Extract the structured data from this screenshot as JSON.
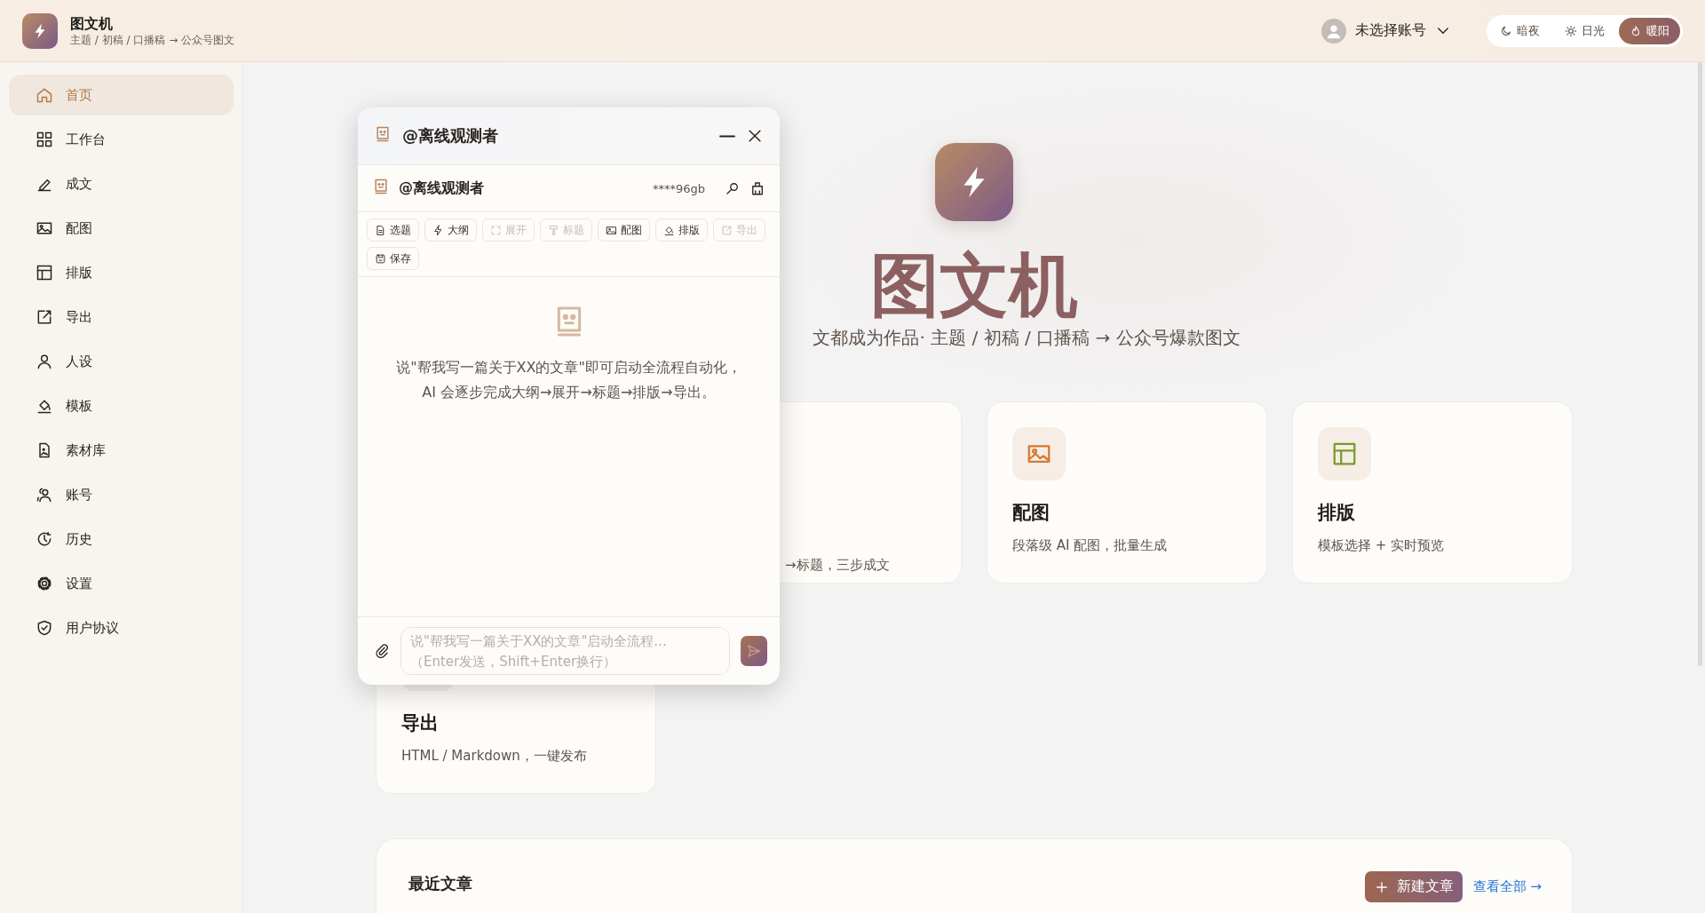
{
  "app": {
    "title": "图文机",
    "breadcrumb": "主题 / 初稿 / 口播稿 → 公众号图文"
  },
  "account": {
    "label": "未选择账号"
  },
  "themes": [
    {
      "label": "暗夜",
      "selected": false
    },
    {
      "label": "日光",
      "selected": false
    },
    {
      "label": "暖阳",
      "selected": true
    }
  ],
  "sidebar": {
    "items": [
      {
        "label": "首页",
        "selected": true
      },
      {
        "label": "工作台",
        "selected": false
      },
      {
        "label": "成文",
        "selected": false
      },
      {
        "label": "配图",
        "selected": false
      },
      {
        "label": "排版",
        "selected": false
      },
      {
        "label": "导出",
        "selected": false
      },
      {
        "label": "人设",
        "selected": false
      },
      {
        "label": "模板",
        "selected": false
      },
      {
        "label": "素材库",
        "selected": false
      },
      {
        "label": "账号",
        "selected": false
      },
      {
        "label": "历史",
        "selected": false
      },
      {
        "label": "设置",
        "selected": false
      },
      {
        "label": "用户协议",
        "selected": false
      }
    ]
  },
  "hero": {
    "title": "图文机",
    "subtitle": "文都成为作品· 主题 / 初稿 / 口播稿 → 公众号爆款图文"
  },
  "features": [
    {
      "kind": "partial",
      "description": "→标题，三步成文"
    },
    {
      "kind": "image",
      "title": "配图",
      "description": "段落级 AI 配图，批量生成"
    },
    {
      "kind": "layout",
      "title": "排版",
      "description": "模板选择 + 实时预览"
    },
    {
      "kind": "export",
      "title": "导出",
      "description": "HTML / Markdown，一键发布"
    }
  ],
  "recent": {
    "title": "最近文章",
    "new_button": "新建文章",
    "view_all": "查看全部 →"
  },
  "chat": {
    "title": "@离线观测者",
    "account": "@离线观测者",
    "key": "****96gb",
    "tools": [
      {
        "label": "选题",
        "disabled": false
      },
      {
        "label": "大纲",
        "disabled": false
      },
      {
        "label": "展开",
        "disabled": true
      },
      {
        "label": "标题",
        "disabled": true
      },
      {
        "label": "配图",
        "disabled": false
      },
      {
        "label": "排版",
        "disabled": false
      },
      {
        "label": "导出",
        "disabled": true
      },
      {
        "label": "保存",
        "disabled": false
      }
    ],
    "empty_hint": "说\"帮我写一篇关于XX的文章\"即可启动全流程自动化，AI 会逐步完成大纲→展开→标题→排版→导出。",
    "input": {
      "placeholder": "说\"帮我写一篇关于XX的文章\"启动全流程...\n（Enter发送，Shift+Enter换行）"
    }
  }
}
